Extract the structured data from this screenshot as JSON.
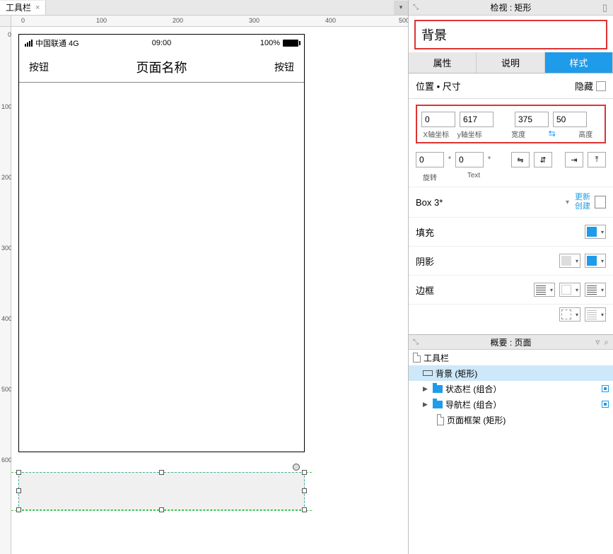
{
  "tab": {
    "title": "工具栏"
  },
  "inspector": {
    "title": "检视 : 矩形",
    "element_name": "背景",
    "tabs": {
      "properties": "属性",
      "notes": "说明",
      "style": "样式"
    },
    "position_size_label": "位置 • 尺寸",
    "hide_label": "隐藏",
    "dims": {
      "x": "0",
      "y": "617",
      "w": "375",
      "h": "50",
      "x_label": "X轴坐标",
      "y_label": "y轴坐标",
      "w_label": "宽度",
      "h_label": "高度"
    },
    "rotation": {
      "shape": "0",
      "text": "0",
      "shape_label": "旋转",
      "text_label": "Text"
    },
    "style_name": "Box 3*",
    "update_label": "更新",
    "create_label": "创建",
    "fill_label": "填充",
    "shadow_label": "阴影",
    "border_label": "边框"
  },
  "outline": {
    "title": "概要 : 页面",
    "items": {
      "page": "工具栏",
      "bg": "背景 (矩形)",
      "status": "状态栏 (组合）",
      "nav": "导航栏 (组合）",
      "frame": "页面框架 (矩形)"
    }
  },
  "phone": {
    "carrier": "中国联通 4G",
    "time": "09:00",
    "battery_pct": "100%",
    "nav_left": "按钮",
    "nav_title": "页面名称",
    "nav_right": "按钮"
  },
  "ruler": {
    "h": [
      "0",
      "100",
      "200",
      "300",
      "400",
      "500"
    ],
    "v": [
      "0",
      "100",
      "200",
      "300",
      "400",
      "500",
      "600"
    ]
  }
}
